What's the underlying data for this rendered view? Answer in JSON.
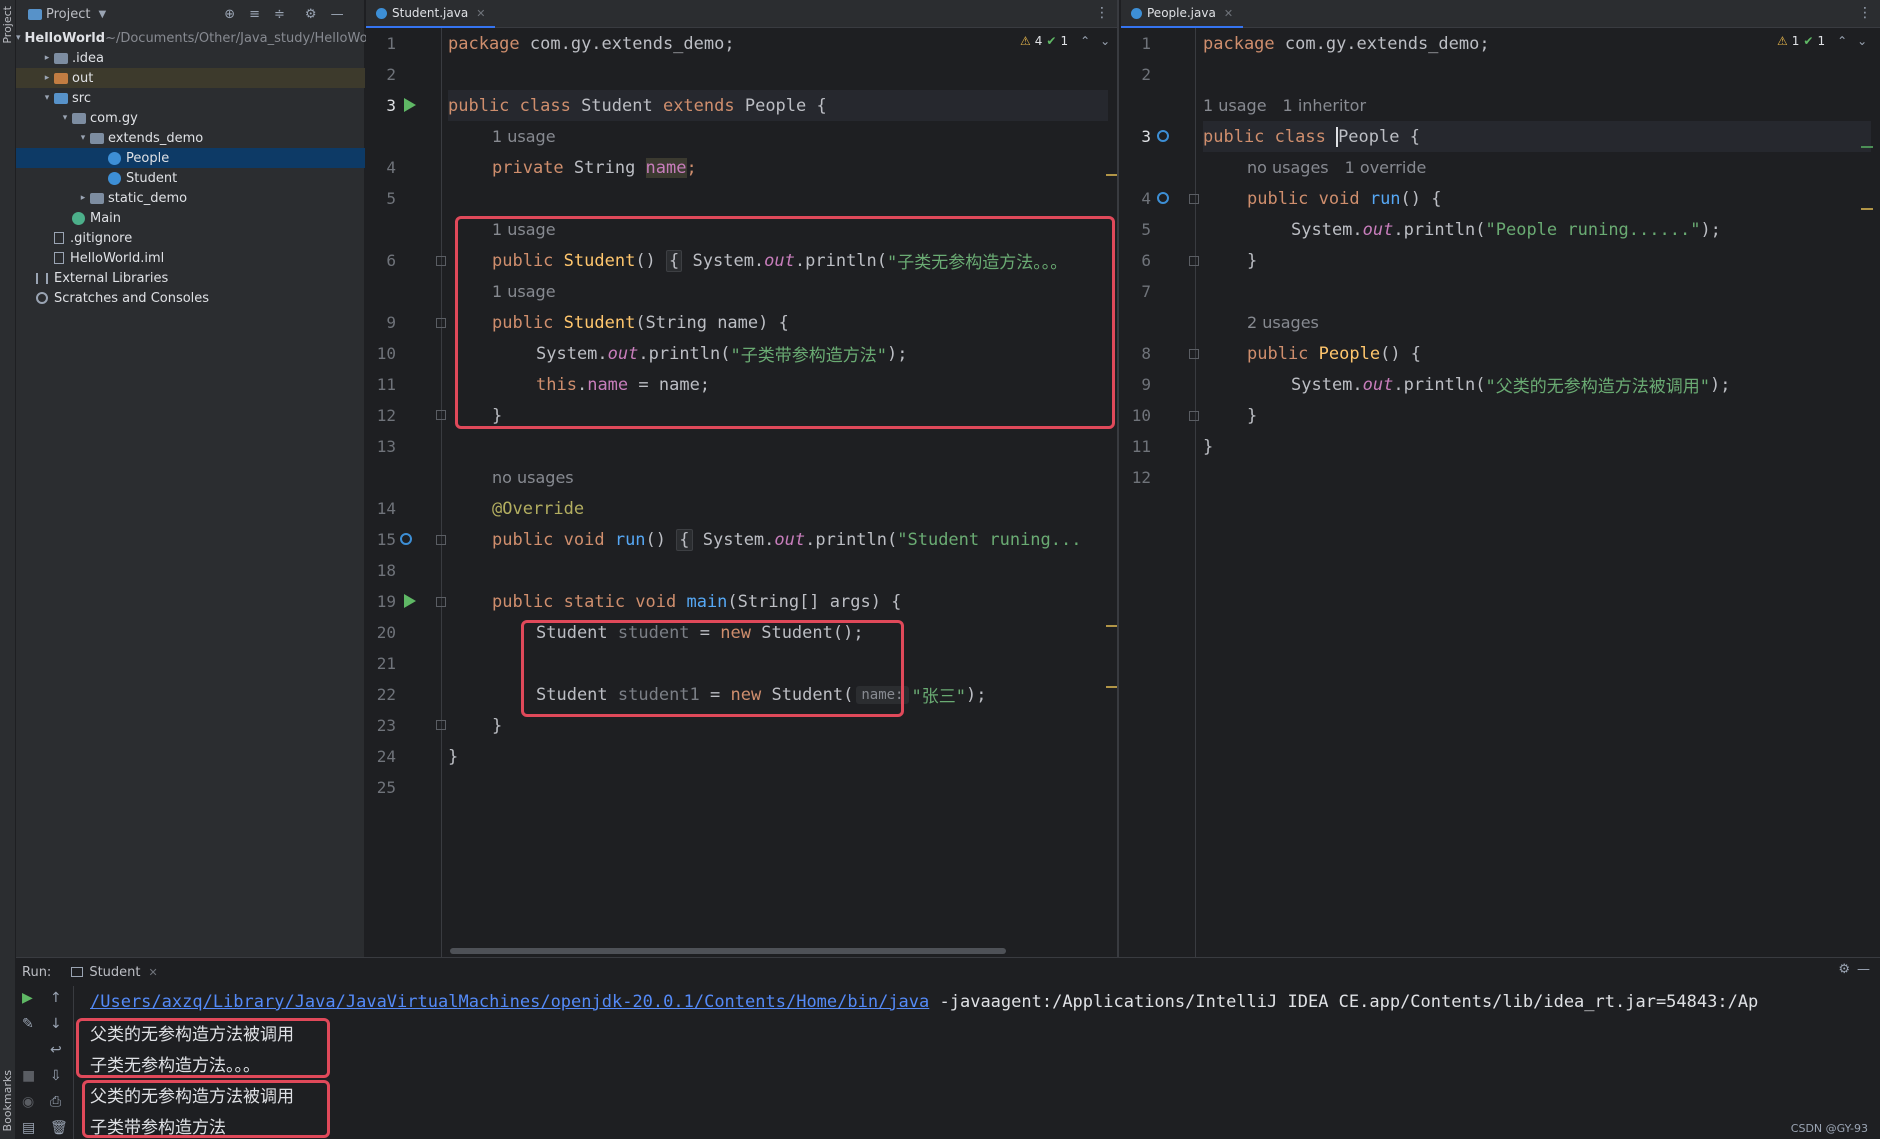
{
  "project_panel": {
    "title": "Project",
    "tree": [
      {
        "label": "HelloWorld",
        "path": " ~/Documents/Other/Java_study/HelloWo",
        "depth": 0,
        "arrow": "▾",
        "icon": "folder"
      },
      {
        "label": ".idea",
        "depth": 1,
        "arrow": "▸",
        "icon": "folder"
      },
      {
        "label": "out",
        "depth": 1,
        "arrow": "▸",
        "icon": "folder-orange"
      },
      {
        "label": "src",
        "depth": 1,
        "arrow": "▾",
        "icon": "folder-blue"
      },
      {
        "label": "com.gy",
        "depth": 2,
        "arrow": "▾",
        "icon": "folder"
      },
      {
        "label": "extends_demo",
        "depth": 3,
        "arrow": "▾",
        "icon": "folder"
      },
      {
        "label": "People",
        "depth": 4,
        "arrow": "",
        "icon": "class"
      },
      {
        "label": "Student",
        "depth": 4,
        "arrow": "",
        "icon": "class"
      },
      {
        "label": "static_demo",
        "depth": 3,
        "arrow": "▸",
        "icon": "folder"
      },
      {
        "label": "Main",
        "depth": 2,
        "arrow": "",
        "icon": "class-main"
      },
      {
        "label": ".gitignore",
        "depth": 1,
        "arrow": "",
        "icon": "file"
      },
      {
        "label": "HelloWorld.iml",
        "depth": 1,
        "arrow": "",
        "icon": "file"
      },
      {
        "label": "External Libraries",
        "depth": 0,
        "arrow": "",
        "icon": "library"
      },
      {
        "label": "Scratches and Consoles",
        "depth": 0,
        "arrow": "",
        "icon": "scratch"
      }
    ]
  },
  "left_editor": {
    "tab": "Student.java",
    "inspections": {
      "warnings": "4",
      "ok": "1"
    },
    "line_numbers": [
      "1",
      "2",
      "3",
      "4",
      "5",
      "6",
      "9",
      "10",
      "11",
      "12",
      "13",
      "14",
      "15",
      "18",
      "19",
      "20",
      "21",
      "22",
      "23",
      "24",
      "25"
    ],
    "hints": {
      "h1": "1 usage",
      "h2": "1 usage",
      "h3": "1 usage",
      "h4": "no usages"
    },
    "code": {
      "l1_kw": "package",
      "l1_rest": " com.gy.extends_demo;",
      "l3_a": "public class ",
      "l3_b": "Student",
      "l3_c": " extends ",
      "l3_d": "People",
      "l3_e": " {",
      "l4_a": "private ",
      "l4_b": "String ",
      "l4_c": "name",
      "l4_d": ";",
      "l6_a": "public ",
      "l6_b": "Student",
      "l6_c": "() ",
      "l6_d": "{",
      "l6_e": " System.",
      "l6_f": "out",
      "l6_g": ".println(",
      "l6_h": "\"子类无参构造方法。。。",
      "l9_a": "public ",
      "l9_b": "Student",
      "l9_c": "(String name) {",
      "l10_a": "System.",
      "l10_b": "out",
      "l10_c": ".println(",
      "l10_d": "\"子类带参构造方法\"",
      "l10_e": ");",
      "l11_a": "this",
      "l11_b": ".",
      "l11_c": "name",
      "l11_d": " = name;",
      "l12": "}",
      "l14": "@Override",
      "l15_a": "public void ",
      "l15_b": "run",
      "l15_c": "() ",
      "l15_d": "{",
      "l15_e": " System.",
      "l15_f": "out",
      "l15_g": ".println(",
      "l15_h": "\"Student runing...",
      "l19_a": "public static void ",
      "l19_b": "main",
      "l19_c": "(String[] args) {",
      "l20_a": "Student ",
      "l20_b": "student",
      "l20_c": " = ",
      "l20_d": "new ",
      "l20_e": "Student();",
      "l22_a": "Student ",
      "l22_b": "student1",
      "l22_c": " = ",
      "l22_d": "new ",
      "l22_e": "Student(",
      "l22_hint": "name:",
      "l22_f": "\"张三\"",
      "l22_g": ");",
      "l23": "}",
      "l24": "}"
    }
  },
  "right_editor": {
    "tab": "People.java",
    "inspections": {
      "warnings": "1",
      "ok": "1"
    },
    "line_numbers": [
      "1",
      "2",
      "3",
      "4",
      "5",
      "6",
      "7",
      "8",
      "9",
      "10",
      "11",
      "12"
    ],
    "hints": {
      "h1a": "1 usage",
      "h1b": "1 inheritor",
      "h2a": "no usages",
      "h2b": "1 override",
      "h3": "2 usages"
    },
    "code": {
      "l1_kw": "package",
      "l1_rest": " com.gy.extends_demo;",
      "l3_a": "public class ",
      "l3_b": "People",
      "l3_c": " {",
      "l4_a": "public void ",
      "l4_b": "run",
      "l4_c": "() {",
      "l5_a": "System.",
      "l5_b": "out",
      "l5_c": ".println(",
      "l5_d": "\"People runing......\"",
      "l5_e": ");",
      "l6": "}",
      "l8_a": "public ",
      "l8_b": "People",
      "l8_c": "() {",
      "l9_a": "System.",
      "l9_b": "out",
      "l9_c": ".println(",
      "l9_d": "\"父类的无参构造方法被调用\"",
      "l9_e": ");",
      "l10": "}",
      "l11": "}"
    }
  },
  "run_panel": {
    "label": "Run:",
    "tab": "Student",
    "cmd_link": "/Users/axzq/Library/Java/JavaVirtualMachines/openjdk-20.0.1/Contents/Home/bin/java",
    "cmd_rest": " -javaagent:/Applications/IntelliJ IDEA CE.app/Contents/lib/idea_rt.jar=54843:/Ap",
    "output": [
      "父类的无参构造方法被调用",
      "子类无参构造方法。。。",
      "父类的无参构造方法被调用",
      "子类带参构造方法"
    ],
    "watermark": "CSDN @GY-93"
  },
  "side_labels": {
    "project": "Project",
    "bookmarks": "Bookmarks"
  }
}
